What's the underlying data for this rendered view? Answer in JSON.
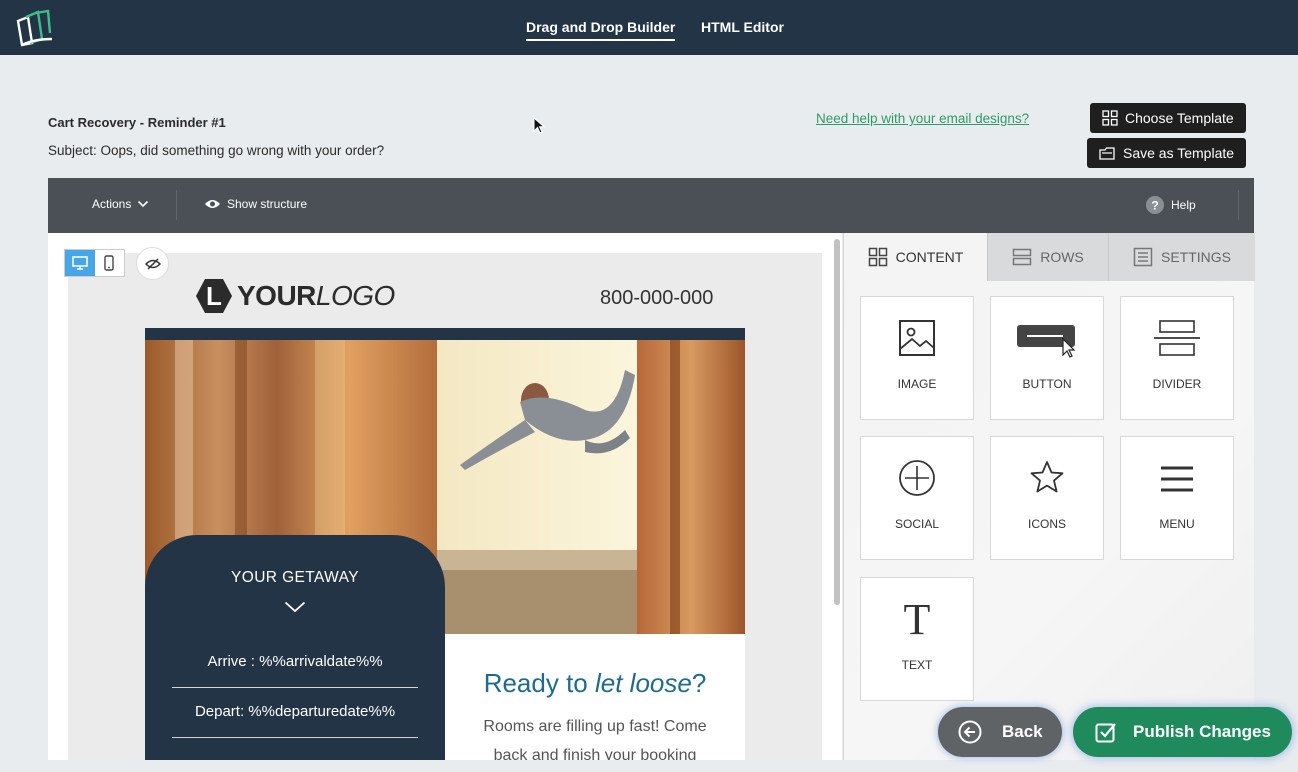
{
  "topbar": {
    "logo_icon": "books-logo-icon",
    "tabs": [
      {
        "label": "Drag and Drop Builder",
        "active": true
      },
      {
        "label": "HTML Editor",
        "active": false
      }
    ]
  },
  "campaign": {
    "title": "Cart Recovery - Reminder #1",
    "subject": "Subject: Oops, did something go wrong with your order?"
  },
  "header_actions": {
    "help_link": "Need help with your email designs?",
    "choose_template": "Choose Template",
    "save_template": "Save as Template"
  },
  "toolbar": {
    "actions": "Actions",
    "show_structure": "Show structure",
    "help": "Help"
  },
  "email": {
    "logo_letter": "L",
    "logo_bold": "YOUR",
    "logo_light": "LOGO",
    "phone": "800-000-000",
    "getaway": {
      "title": "YOUR GETAWAY",
      "arrive": "Arrive : %%arrivaldate%%",
      "depart": "Depart: %%departuredate%%"
    },
    "promo": {
      "heading_start": "Ready to ",
      "heading_em": "let loose",
      "heading_end": "?",
      "body": "Rooms are filling up fast! Come back and finish your booking"
    }
  },
  "panel": {
    "tabs": [
      {
        "label": "CONTENT",
        "icon": "grid-icon",
        "active": true
      },
      {
        "label": "ROWS",
        "icon": "rows-icon",
        "active": false
      },
      {
        "label": "SETTINGS",
        "icon": "settings-list-icon",
        "active": false
      }
    ],
    "blocks": [
      "IMAGE",
      "BUTTON",
      "DIVIDER",
      "SOCIAL",
      "ICONS",
      "MENU",
      "TEXT"
    ]
  },
  "footer_buttons": {
    "back": "Back",
    "publish": "Publish Changes"
  },
  "colors": {
    "topbar": "#243447",
    "accent_green": "#1f8a5c",
    "link_green": "#2e9c6a",
    "toolbar": "#4a5055",
    "device_active": "#47a7e6"
  }
}
